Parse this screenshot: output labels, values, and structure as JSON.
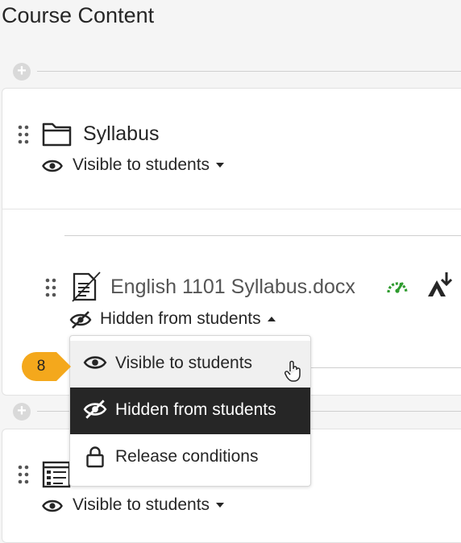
{
  "page": {
    "title": "Course Content"
  },
  "modules": [
    {
      "title": "Syllabus",
      "visibility": "Visible to students"
    },
    {
      "visibility": "Visible to students"
    }
  ],
  "item": {
    "title": "English 1101 Syllabus.docx",
    "visibility": "Hidden from students"
  },
  "dropdown": {
    "options": [
      "Visible to students",
      "Hidden from students",
      "Release conditions"
    ],
    "selected": "Hidden from students",
    "hovered": "Visible to students"
  },
  "step_badge": {
    "number": "8",
    "color": "#f4a81c"
  },
  "colors": {
    "selected_bg": "#262626",
    "gauge": "#2e9b2e"
  },
  "icons": [
    "drag-handle-icon",
    "folder-icon",
    "eye-icon",
    "document-icon",
    "gauge-icon",
    "accessibility-icon",
    "eye-slash-icon",
    "lock-icon",
    "hand-pointer-icon",
    "plus-icon"
  ]
}
